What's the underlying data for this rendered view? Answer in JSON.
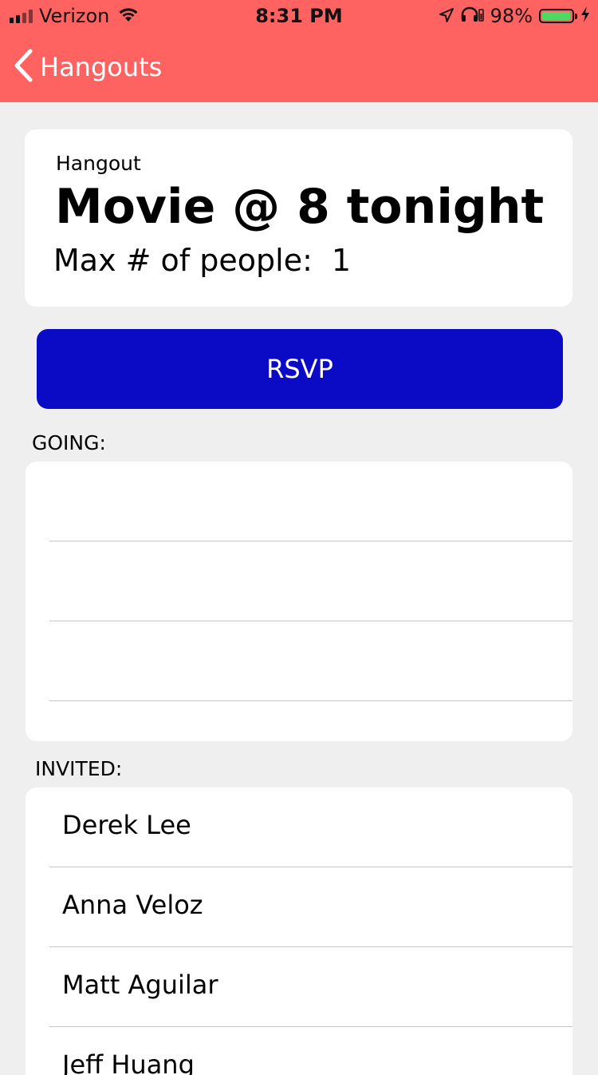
{
  "status_bar": {
    "carrier": "Verizon",
    "time": "8:31 PM",
    "battery_percent": "98%",
    "battery_level": 0.98,
    "battery_color": "#4cd964",
    "icons": [
      "signal-icon",
      "wifi-icon",
      "location-arrow-icon",
      "headphones-icon",
      "battery-icon",
      "charging-bolt-icon"
    ]
  },
  "nav": {
    "back_label": "Hangouts",
    "bar_color": "#fe6361"
  },
  "hangout": {
    "label": "Hangout",
    "title": "Movie @ 8 tonight",
    "max_label": "Max # of people:",
    "max_value": "1"
  },
  "rsvp": {
    "label": "RSVP",
    "color": "#0b0ac5"
  },
  "going": {
    "header": "GOING:",
    "rows": [
      "",
      "",
      ""
    ]
  },
  "invited": {
    "header": "INVITED:",
    "rows": [
      "Derek Lee",
      "Anna Veloz",
      "Matt Aguilar",
      "Jeff Huang"
    ]
  }
}
